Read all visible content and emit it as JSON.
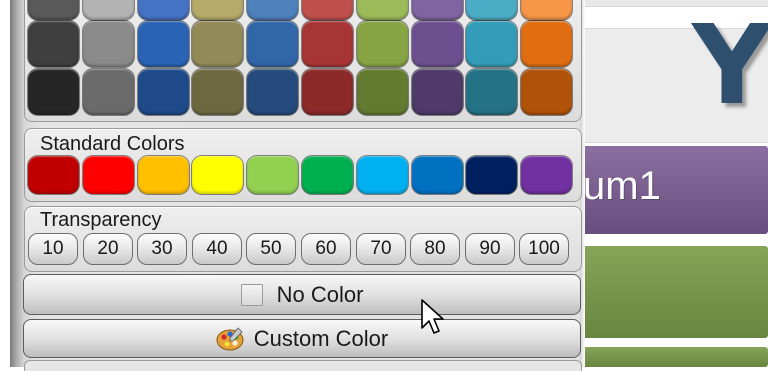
{
  "palette": {
    "theme_colors": {
      "rows": [
        [
          "#595959",
          "#b3b3b3",
          "#4472c4",
          "#b5aa6a",
          "#4f81bd",
          "#c0504d",
          "#9bbb59",
          "#8064a2",
          "#4bacc6",
          "#f79646"
        ],
        [
          "#3f3f3f",
          "#8a8a8a",
          "#2a63b4",
          "#928a57",
          "#3167a8",
          "#a83535",
          "#86a444",
          "#6d4f90",
          "#339cb8",
          "#e06d12"
        ],
        [
          "#262626",
          "#6b6b6b",
          "#1e4a8a",
          "#6e6841",
          "#254a7c",
          "#8c2a2a",
          "#637a31",
          "#4f3a6a",
          "#247285",
          "#b15209"
        ]
      ]
    },
    "standard_colors": {
      "label": "Standard Colors",
      "swatches": [
        "#c00000",
        "#ff0000",
        "#ffc000",
        "#ffff00",
        "#92d050",
        "#00b050",
        "#00b0f0",
        "#0070c0",
        "#002060",
        "#7030a0"
      ]
    },
    "transparency": {
      "label": "Transparency",
      "options": [
        "10",
        "20",
        "30",
        "40",
        "50",
        "60",
        "70",
        "80",
        "90",
        "100"
      ]
    },
    "no_color": {
      "label": "No Color"
    },
    "custom_color": {
      "label": "Custom Color",
      "icon": "palette-icon"
    }
  },
  "document": {
    "title_letter": "Y",
    "row_text": "um1",
    "row_colors": [
      "#7a5f92",
      "#76954c"
    ]
  },
  "cursor": {
    "icon": "arrow-cursor-icon"
  }
}
